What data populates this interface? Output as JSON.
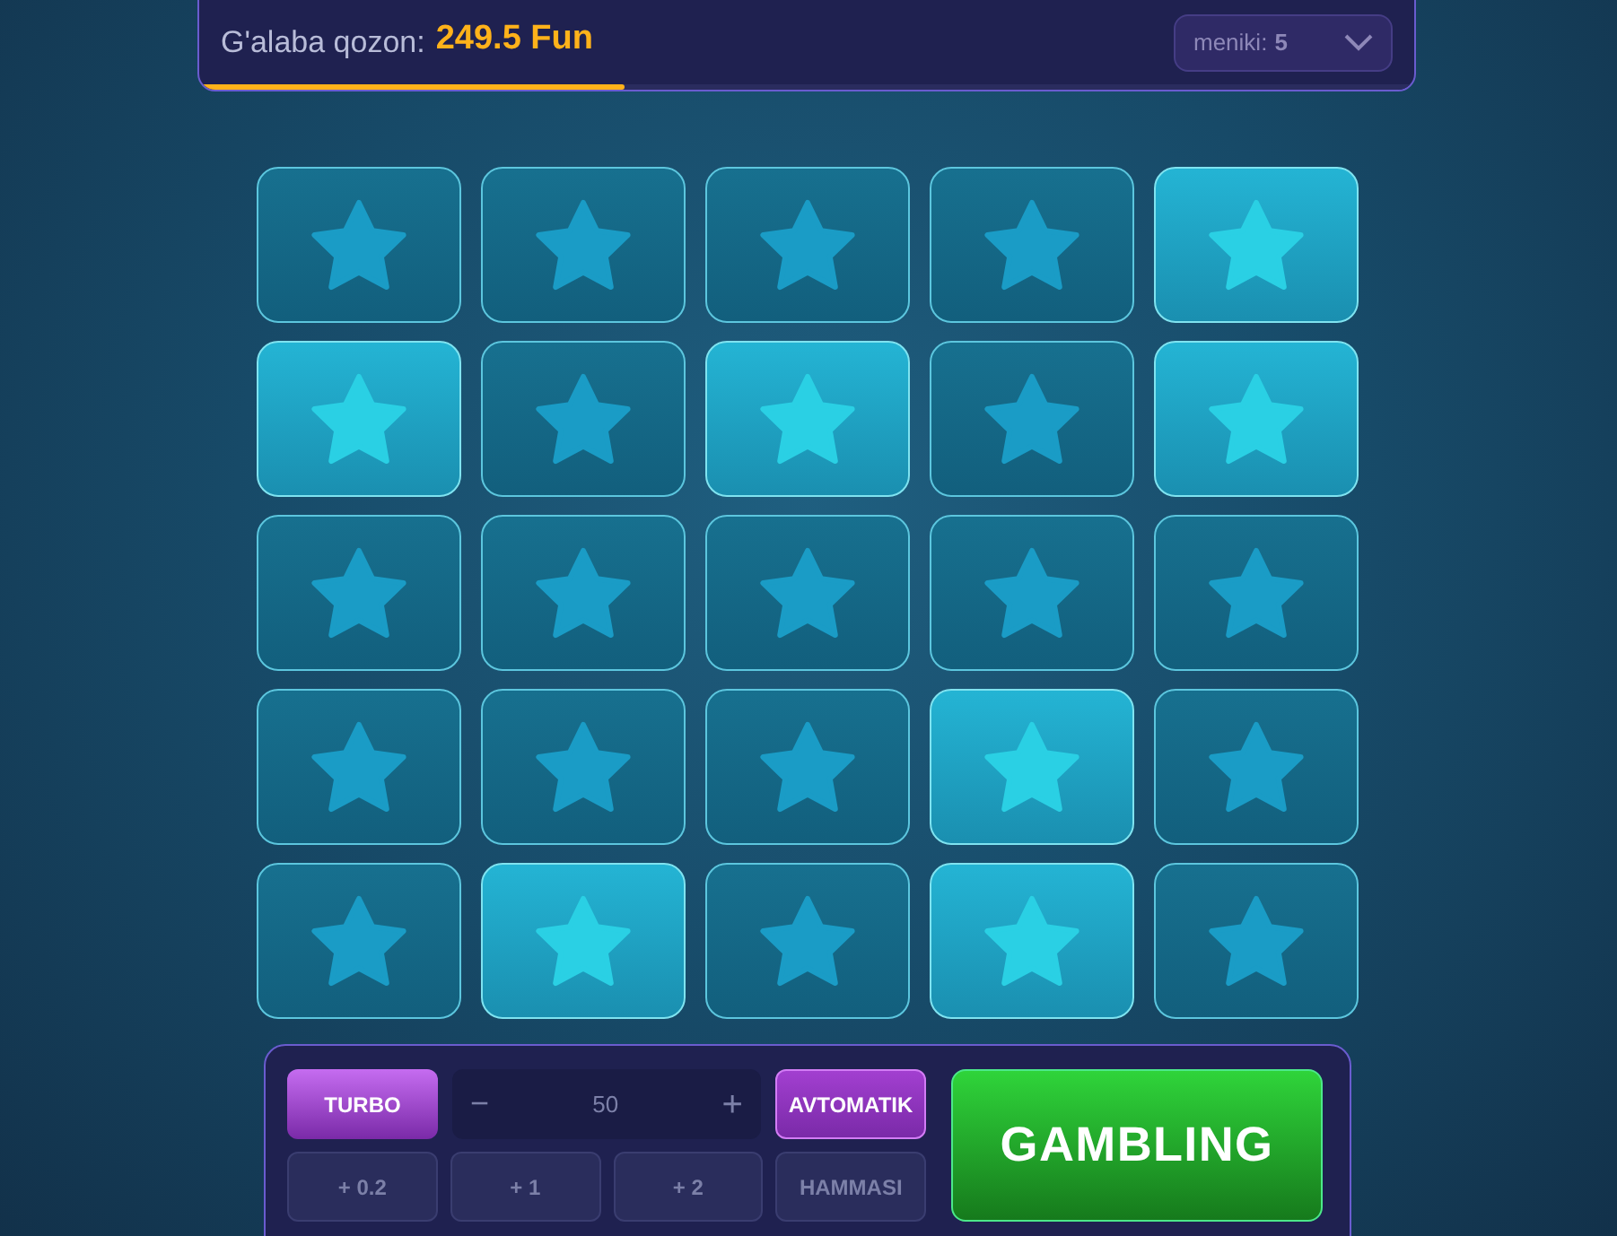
{
  "header": {
    "label": "G'alaba qozon:",
    "amount": "249.5 Fun",
    "progress": {
      "level": 0.35
    },
    "mines_select": {
      "label": "meniki:",
      "value": "5"
    }
  },
  "tiles": [
    {
      "lit": false
    },
    {
      "lit": false
    },
    {
      "lit": false
    },
    {
      "lit": false
    },
    {
      "lit": true
    },
    {
      "lit": true
    },
    {
      "lit": false
    },
    {
      "lit": true
    },
    {
      "lit": false
    },
    {
      "lit": true
    },
    {
      "lit": false
    },
    {
      "lit": false
    },
    {
      "lit": false
    },
    {
      "lit": false
    },
    {
      "lit": false
    },
    {
      "lit": false
    },
    {
      "lit": false
    },
    {
      "lit": false
    },
    {
      "lit": true
    },
    {
      "lit": false
    },
    {
      "lit": false
    },
    {
      "lit": true
    },
    {
      "lit": false
    },
    {
      "lit": true
    },
    {
      "lit": false
    }
  ],
  "controls": {
    "turbo": "TURBO",
    "stepper": {
      "minus": "−",
      "value": "50",
      "plus": "+"
    },
    "auto": "AVTOMATIK",
    "quick": [
      "+ 0.2",
      "+ 1",
      "+ 2",
      "HAMMASI"
    ],
    "play": "GAMBLING"
  }
}
